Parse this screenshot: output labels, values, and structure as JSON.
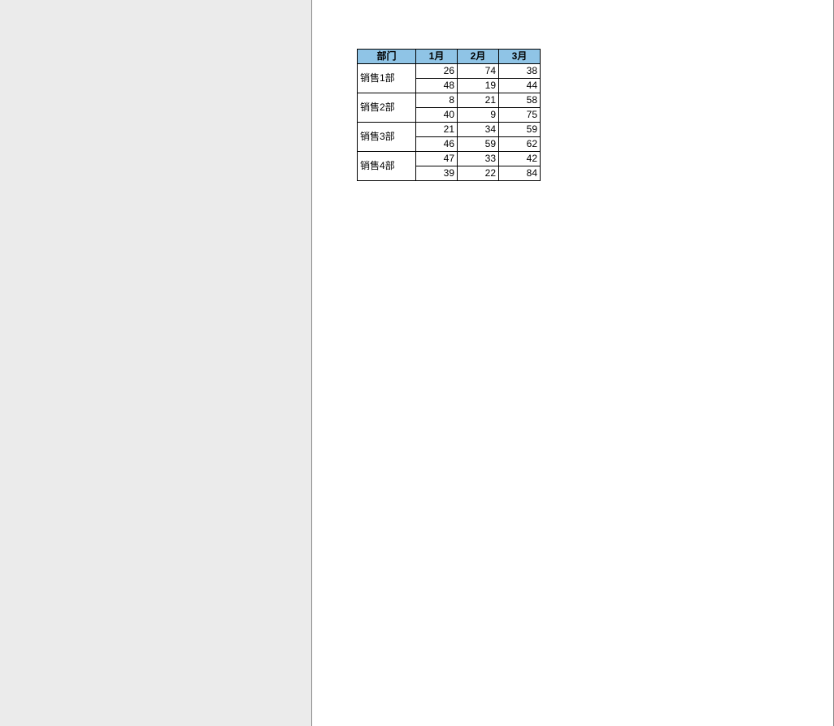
{
  "table": {
    "headers": {
      "dept": "部门",
      "m1": "1月",
      "m2": "2月",
      "m3": "3月"
    },
    "groups": [
      {
        "dept": "销售1部",
        "rows": [
          {
            "m1": "26",
            "m2": "74",
            "m3": "38"
          },
          {
            "m1": "48",
            "m2": "19",
            "m3": "44"
          }
        ]
      },
      {
        "dept": "销售2部",
        "rows": [
          {
            "m1": "8",
            "m2": "21",
            "m3": "58"
          },
          {
            "m1": "40",
            "m2": "9",
            "m3": "75"
          }
        ]
      },
      {
        "dept": "销售3部",
        "rows": [
          {
            "m1": "21",
            "m2": "34",
            "m3": "59"
          },
          {
            "m1": "46",
            "m2": "59",
            "m3": "62"
          }
        ]
      },
      {
        "dept": "销售4部",
        "rows": [
          {
            "m1": "47",
            "m2": "33",
            "m3": "42"
          },
          {
            "m1": "39",
            "m2": "22",
            "m3": "84"
          }
        ]
      }
    ]
  },
  "chart_data": {
    "type": "table",
    "title": "",
    "columns": [
      "部门",
      "1月",
      "2月",
      "3月"
    ],
    "rows": [
      [
        "销售1部",
        26,
        74,
        38
      ],
      [
        "销售1部",
        48,
        19,
        44
      ],
      [
        "销售2部",
        8,
        21,
        58
      ],
      [
        "销售2部",
        40,
        9,
        75
      ],
      [
        "销售3部",
        21,
        34,
        59
      ],
      [
        "销售3部",
        46,
        59,
        62
      ],
      [
        "销售4部",
        47,
        33,
        42
      ],
      [
        "销售4部",
        39,
        22,
        84
      ]
    ]
  }
}
